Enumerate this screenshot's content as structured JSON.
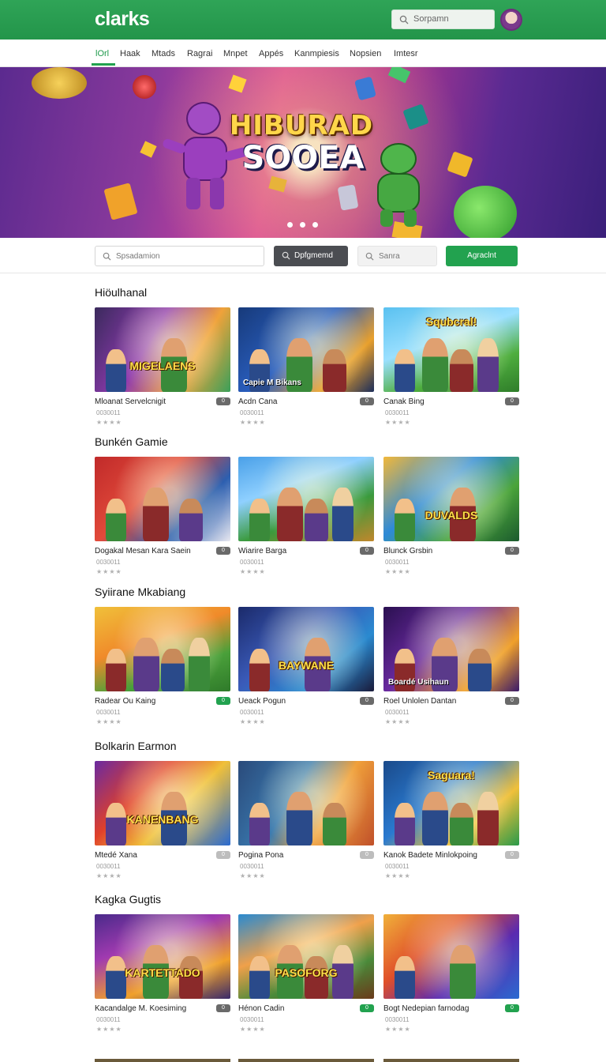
{
  "header": {
    "logo": "clarks",
    "search_placeholder": "Sorpamn",
    "avatar": "user-avatar"
  },
  "nav": {
    "items": [
      "lOrl",
      "Haak",
      "Mtads",
      "Ragrai",
      "Mnpet",
      "Appés",
      "Kanmpiesis",
      "Nopsien",
      "Imtesr"
    ],
    "active_index": 0
  },
  "hero": {
    "title_line1": "HIBURAD",
    "title_line2": "SOOEA",
    "slide_count": 3
  },
  "filters": {
    "search_placeholder": "Spsadamion",
    "select_label": "Dpfgmemd",
    "secondary_placeholder": "Sanra",
    "apply_label": "Agraclnt"
  },
  "sections": [
    {
      "title": "Hiöulhanal",
      "cards": [
        {
          "name": "Mloanat Servelcnigit",
          "badge": "0",
          "meta": "0030011",
          "stars": "★★★★",
          "banner": "MIGELAENS",
          "caption": ""
        },
        {
          "name": "Acdn Cana",
          "badge": "0",
          "meta": "0030011",
          "stars": "★★★★",
          "banner": "",
          "caption": "Capie M Bikans"
        },
        {
          "name": "Canak Bing",
          "badge": "0",
          "meta": "0030011",
          "stars": "★★★★",
          "banner": "Squbcral!",
          "caption": ""
        }
      ]
    },
    {
      "title": "Bunkén Gamie",
      "cards": [
        {
          "name": "Dogakal Mesan Kara Saein",
          "badge": "0",
          "meta": "0030011",
          "stars": "★★★★",
          "banner": "",
          "caption": ""
        },
        {
          "name": "Wiarire Barga",
          "badge": "0",
          "meta": "0030011",
          "stars": "★★★★",
          "banner": "",
          "caption": ""
        },
        {
          "name": "Blunck Grsbin",
          "badge": "0",
          "meta": "0030011",
          "stars": "★★★★",
          "banner": "DUVALDS",
          "caption": ""
        }
      ]
    },
    {
      "title": "Syiirane Mkabiang",
      "cards": [
        {
          "name": "Radear Ou Kaing",
          "badge": "0",
          "meta": "0030011",
          "stars": "★★★★",
          "banner": "",
          "caption": "",
          "badge_style": "green"
        },
        {
          "name": "Ueack Pogun",
          "badge": "0",
          "meta": "0030011",
          "stars": "★★★★",
          "banner": "BAYWANE",
          "caption": ""
        },
        {
          "name": "Roel Unlolen Dantan",
          "badge": "0",
          "meta": "0030011",
          "stars": "★★★★",
          "banner": "",
          "caption": "Boardé Usihaun"
        }
      ]
    },
    {
      "title": "Bolkarin Earmon",
      "cards": [
        {
          "name": "Mtedé Xana",
          "badge": "0",
          "meta": "0030011",
          "stars": "★★★★",
          "banner": "KANENBANG",
          "caption": "",
          "badge_style": "light"
        },
        {
          "name": "Pogina Pona",
          "badge": "0",
          "meta": "0030011",
          "stars": "★★★★",
          "banner": "",
          "caption": "",
          "badge_style": "light"
        },
        {
          "name": "Kanok Badete Minlokpoing",
          "badge": "0",
          "meta": "0030011",
          "stars": "★★★★",
          "banner": "Saguara!",
          "caption": "",
          "badge_style": "light"
        }
      ]
    },
    {
      "title": "Kagka Gugtis",
      "cards": [
        {
          "name": "Kacandalge M. Koesiming",
          "badge": "0",
          "meta": "0030011",
          "stars": "★★★★",
          "banner": "KARTETTADO",
          "caption": ""
        },
        {
          "name": "Hénon Cadin",
          "badge": "0",
          "meta": "0030011",
          "stars": "★★★★",
          "banner": "PASOFORG",
          "caption": "",
          "badge_style": "green"
        },
        {
          "name": "Bogt Nedepian farnodag",
          "badge": "0",
          "meta": "0030011",
          "stars": "★★★★",
          "banner": "",
          "caption": "",
          "badge_style": "green"
        }
      ]
    }
  ],
  "colors": {
    "brand_green": "#22a24f",
    "header_green": "#2fa457",
    "dark_select": "#4b4d52"
  }
}
